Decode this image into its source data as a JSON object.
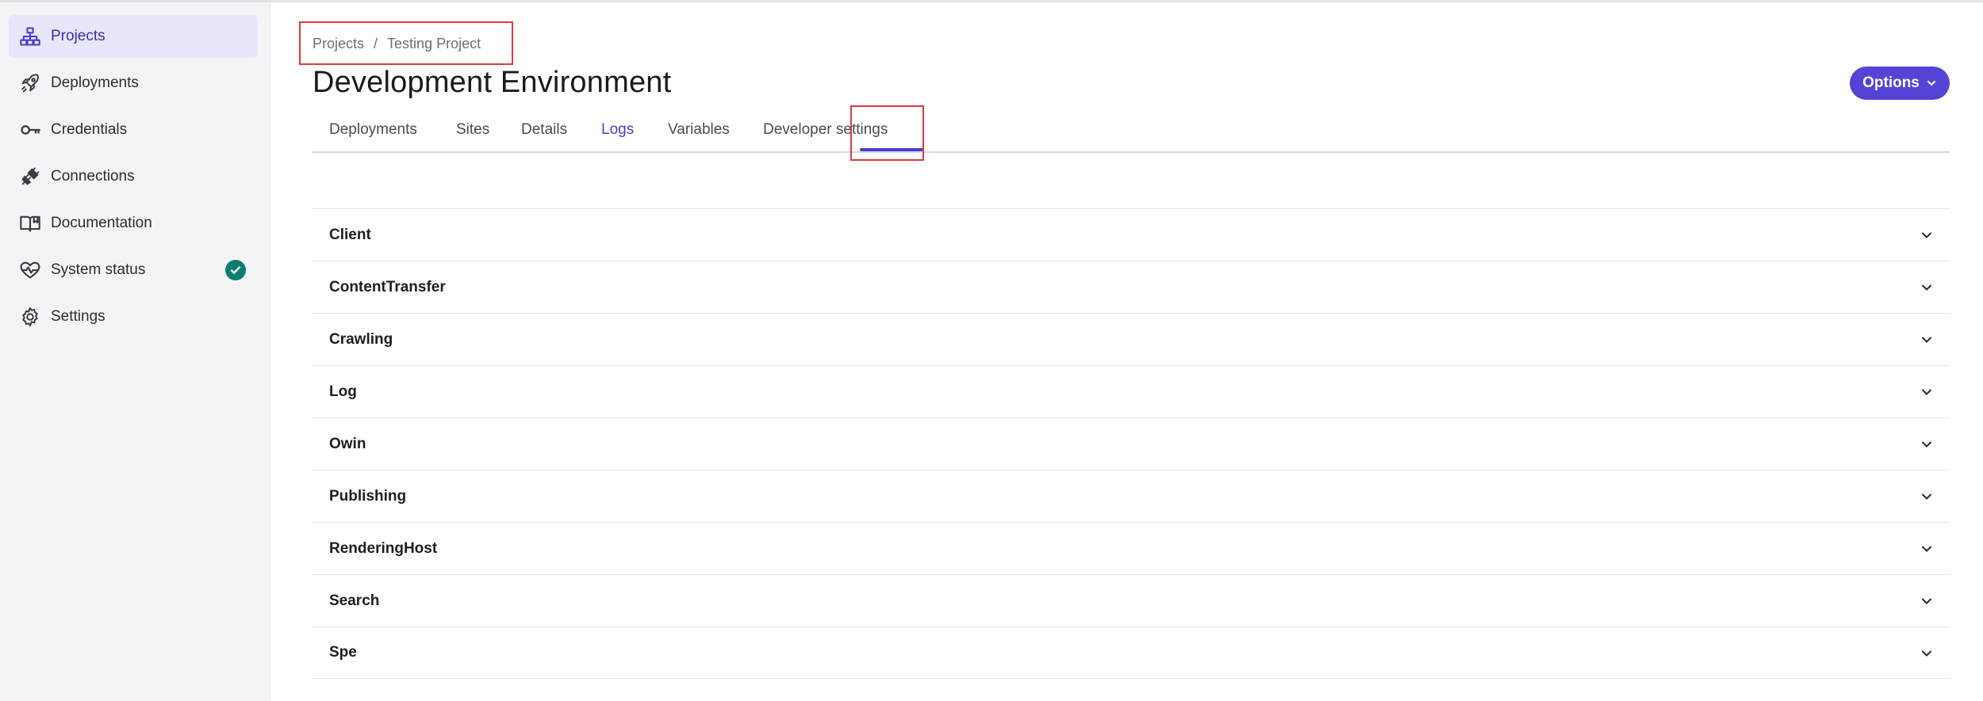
{
  "sidebar": {
    "items": [
      {
        "label": "Projects",
        "icon": "sitemap-icon",
        "active": true
      },
      {
        "label": "Deployments",
        "icon": "rocket-icon",
        "active": false
      },
      {
        "label": "Credentials",
        "icon": "key-icon",
        "active": false
      },
      {
        "label": "Connections",
        "icon": "plug-icon",
        "active": false
      },
      {
        "label": "Documentation",
        "icon": "book-icon",
        "active": false
      },
      {
        "label": "System status",
        "icon": "heartbeat-icon",
        "active": false,
        "badge": "check-circle-icon"
      },
      {
        "label": "Settings",
        "icon": "gear-icon",
        "active": false
      }
    ]
  },
  "breadcrumb": {
    "items": [
      "Projects",
      "Testing Project"
    ],
    "separator": "/"
  },
  "header": {
    "title": "Development Environment",
    "options_label": "Options"
  },
  "tabs": [
    {
      "label": "Deployments"
    },
    {
      "label": "Sites"
    },
    {
      "label": "Details"
    },
    {
      "label": "Logs",
      "active": true
    },
    {
      "label": "Variables"
    },
    {
      "label": "Developer settings"
    }
  ],
  "logs": {
    "groups": [
      "Client",
      "ContentTransfer",
      "Crawling",
      "Log",
      "Owin",
      "Publishing",
      "RenderingHost",
      "Search",
      "Spe"
    ]
  },
  "colors": {
    "accent": "#5444d6",
    "active_nav_bg": "#e8e6fb",
    "highlight_box": "#e0393e",
    "status_ok": "#0b7e72"
  }
}
